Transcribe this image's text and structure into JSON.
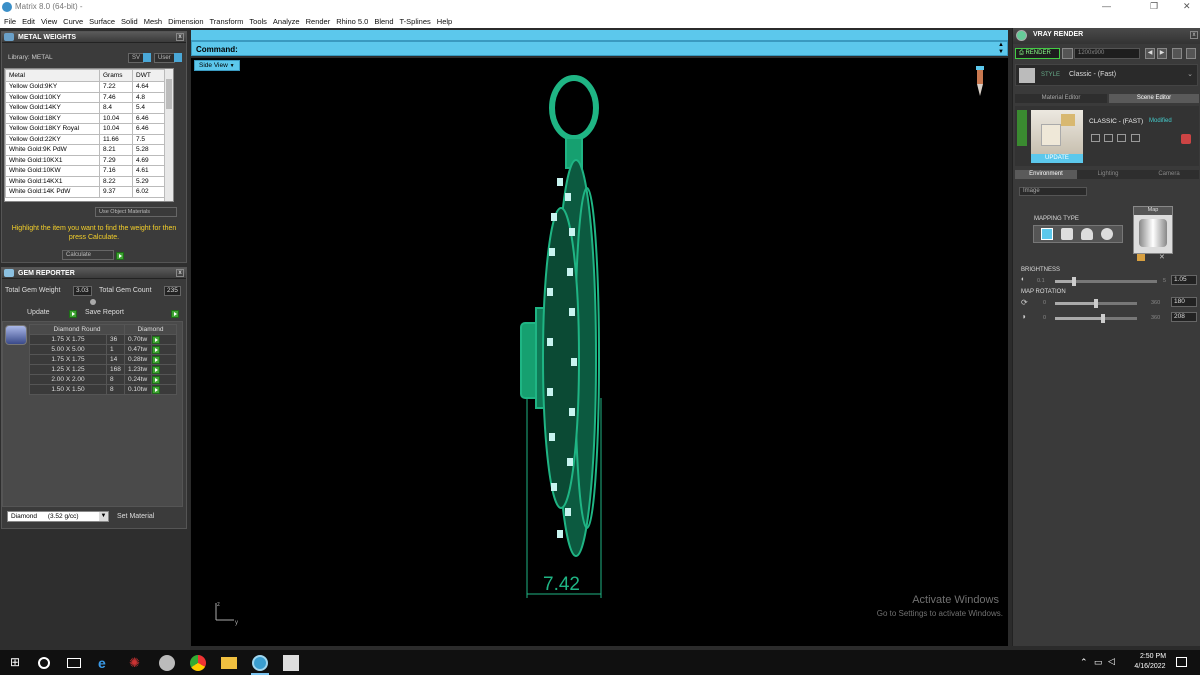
{
  "window": {
    "title": "Matrix 8.0 (64-bit) -"
  },
  "menu": [
    "File",
    "Edit",
    "View",
    "Curve",
    "Surface",
    "Solid",
    "Mesh",
    "Dimension",
    "Transform",
    "Tools",
    "Analyze",
    "Render",
    "Rhino 5.0",
    "Blend",
    "T-Splines",
    "Help"
  ],
  "metal_weights": {
    "title": "METAL WEIGHTS",
    "library_label": "Library: METAL",
    "btn_sv": "SV",
    "btn_user": "User",
    "columns": [
      "Metal",
      "Grams",
      "DWT"
    ],
    "rows": [
      [
        "Yellow Gold:9KY",
        "7.22",
        "4.64"
      ],
      [
        "Yellow Gold:10KY",
        "7.46",
        "4.8"
      ],
      [
        "Yellow Gold:14KY",
        "8.4",
        "5.4"
      ],
      [
        "Yellow Gold:18KY",
        "10.04",
        "6.46"
      ],
      [
        "Yellow Gold:18KY Royal",
        "10.04",
        "6.46"
      ],
      [
        "Yellow Gold:22KY",
        "11.66",
        "7.5"
      ],
      [
        "White Gold:9K PdW",
        "8.21",
        "5.28"
      ],
      [
        "White Gold:10KX1",
        "7.29",
        "4.69"
      ],
      [
        "White Gold:10KW",
        "7.16",
        "4.61"
      ],
      [
        "White Gold:14KX1",
        "8.22",
        "5.29"
      ],
      [
        "White Gold:14K PdW",
        "9.37",
        "6.02"
      ]
    ],
    "use_object_materials": "Use Object Materials",
    "hint": "Highlight the item you want to find the weight for then press Calculate.",
    "calculate": "Calculate"
  },
  "gem_reporter": {
    "title": "GEM REPORTER",
    "total_weight_label": "Total Gem Weight",
    "total_weight": "3.03",
    "total_count_label": "Total Gem Count",
    "total_count": "235",
    "update": "Update",
    "save_report": "Save Report",
    "columns": [
      "Diamond Round",
      "Diamond"
    ],
    "rows": [
      [
        "1.75 X 1.75",
        "36",
        "0.70tw"
      ],
      [
        "5.00 X 5.00",
        "1",
        "0.47tw"
      ],
      [
        "1.75 X 1.75",
        "14",
        "0.28tw"
      ],
      [
        "1.25 X 1.25",
        "168",
        "1.23tw"
      ],
      [
        "2.00 X 2.00",
        "8",
        "0.24tw"
      ],
      [
        "1.50 X 1.50",
        "8",
        "0.10tw"
      ]
    ],
    "material_select": "Diamond      (3.52 g/cc)",
    "set_material": "Set Material"
  },
  "command": {
    "label": "Command:"
  },
  "viewport": {
    "view_name": "Side View",
    "dimension": "7.42",
    "axis_z": "z",
    "axis_y": "y",
    "activate_title": "Activate Windows",
    "activate_sub": "Go to Settings to activate Windows."
  },
  "vray": {
    "title": "VRAY RENDER",
    "render_btn": "RENDER",
    "resolution": "1200x900",
    "style_label": "STYLE",
    "style_value": "Classic - (Fast)",
    "tabs": [
      "Material Editor",
      "Scene Editor"
    ],
    "scene_name": "CLASSIC - (FAST)",
    "modified": "Modified",
    "update": "UPDATE",
    "env_tabs": [
      "Environment",
      "Lighting",
      "Camera"
    ],
    "env_select": "Image",
    "mapping_type": "MAPPING TYPE",
    "map_label": "Map",
    "brightness_label": "BRIGHTNESS",
    "brightness_min": "0.1",
    "brightness_max": "5",
    "brightness_value": "1.05",
    "brightness_level": 0.19,
    "map_rotation_label": "MAP ROTATION",
    "rot1_min": "0",
    "rot1_max": "360",
    "rot1_value": "180",
    "rot1_level": 0.5,
    "rot2_min": "0",
    "rot2_max": "360",
    "rot2_value": "208",
    "rot2_level": 0.58
  },
  "taskbar": {
    "time": "2:50 PM",
    "date": "4/16/2022"
  },
  "colors": {
    "model": "#1fb584",
    "accent": "#5cc8ec",
    "go": "#3ea332"
  }
}
